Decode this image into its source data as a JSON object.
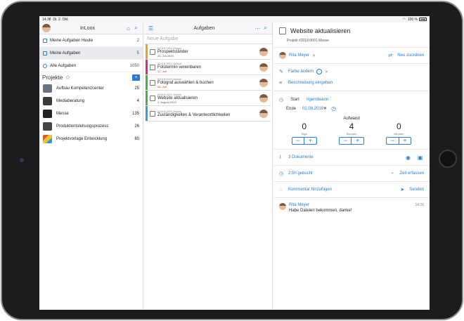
{
  "status": {
    "time": "14:38",
    "date": "Di. 2. Okt.",
    "battery": "100 %"
  },
  "left": {
    "title": "InLoox",
    "smart": [
      {
        "label": "Meine Aufgaben Heute",
        "count": "2"
      },
      {
        "label": "Meine Aufgaben",
        "count": "5"
      },
      {
        "label": "Alle Aufgaben",
        "count": "1050"
      }
    ],
    "projects_title": "Projekte",
    "add": "+",
    "projects": [
      {
        "label": "Aufbau Kompetenzcenter",
        "count": "25",
        "color": "#6a7480"
      },
      {
        "label": "Mediaberatung",
        "count": "4",
        "color": "#3a3a3a"
      },
      {
        "label": "Messe",
        "count": "135",
        "color": "#222222"
      },
      {
        "label": "Produktentstehungsprozess",
        "count": "26",
        "color": "#444444"
      },
      {
        "label": "Projektvorlage Entwicklung",
        "count": "80",
        "color": "#e05a2a"
      }
    ]
  },
  "middle": {
    "title": "Aufgaben",
    "new_task": "Neue Aufgabe",
    "tasks": [
      {
        "meta": "#2018-0001 Messe",
        "name": "Prospektständer",
        "date": "26. Juli 2019",
        "late": false,
        "color": "#f0a21d"
      },
      {
        "meta": "#2018-0001 Messe",
        "name": "Fototermin vereinbaren",
        "date": "17. Juli",
        "late": true,
        "color": "#e0287e"
      },
      {
        "meta": "#2018-0001 Messe",
        "name": "Fotograf auswählen & buchen",
        "date": "26. Juli",
        "late": true,
        "color": "#46b04a"
      },
      {
        "meta": "#2018-0001 Messe",
        "name": "Website aktualisieren",
        "date": "2. August 2019",
        "late": false,
        "color": "#46b04a"
      },
      {
        "meta": "#2018-0001 Messe",
        "name": "Zuständigkeiten & Verantwortlichkeiten",
        "date": "",
        "late": false,
        "color": "#2aa3e0"
      }
    ]
  },
  "detail": {
    "title": "Website aktualisieren",
    "project": "Projekt #2018-0001 Messe",
    "assignee": "Rita Meyer",
    "assign_new": "Neu zuordnen",
    "color_label": "Farbe ändern",
    "description": "Beschreibung eingeben",
    "start_label": "Start",
    "start_value": "irgendwann",
    "end_label": "Ende",
    "end_value": "02.08.2019",
    "effort_title": "Aufwand",
    "effort": [
      {
        "value": "0",
        "unit": "Tage"
      },
      {
        "value": "4",
        "unit": "Stunden"
      },
      {
        "value": "0",
        "unit": "Minuten"
      }
    ],
    "documents": "3 Dokumente",
    "booked": "2,5h gebucht",
    "track_time": "Zeit erfassen",
    "comment_placeholder": "Kommentar hinzufügen",
    "send": "Senden",
    "comment": {
      "author": "Rita Meyer",
      "text": "Habe Dateien bekommen, danke!",
      "time": "14:26"
    }
  }
}
